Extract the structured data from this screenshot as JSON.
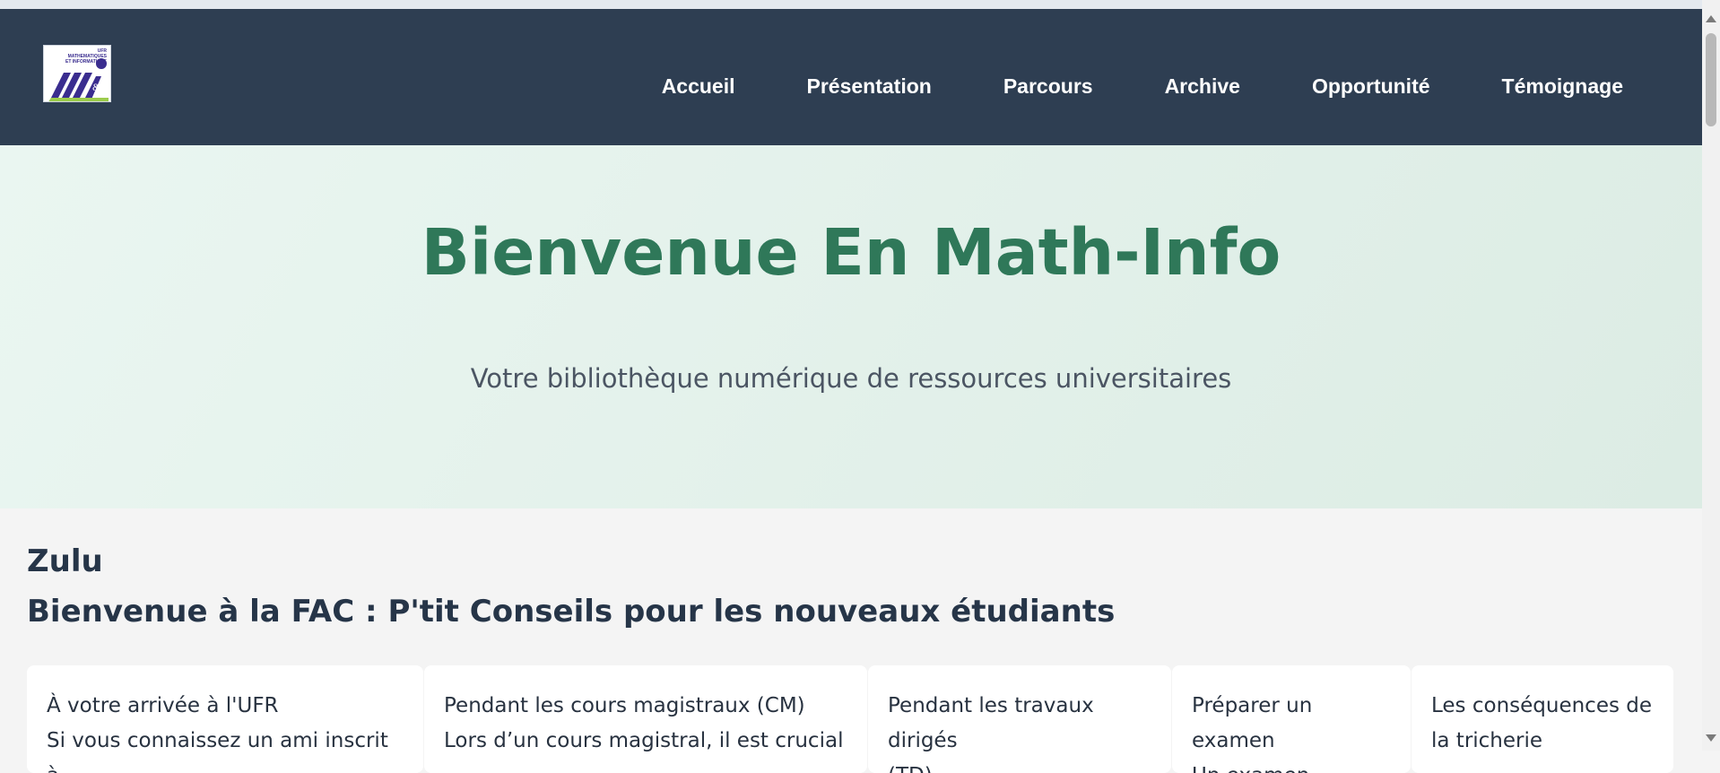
{
  "logo": {
    "line1": "UFR",
    "line2": "MATHEMATIQUES",
    "line3": "ET INFORMATIQUE"
  },
  "nav": {
    "items": [
      {
        "label": "Accueil"
      },
      {
        "label": "Présentation"
      },
      {
        "label": "Parcours"
      },
      {
        "label": "Archive"
      },
      {
        "label": "Opportunité"
      },
      {
        "label": "Témoignage"
      }
    ]
  },
  "hero": {
    "title": "Bienvenue En Math-Info",
    "subtitle": "Votre bibliothèque numérique de ressources universitaires"
  },
  "section": {
    "name": "Zulu",
    "title": "Bienvenue à la FAC : P'tit Conseils pour les nouveaux étudiants"
  },
  "cards": [
    {
      "heading": "À votre arrivée à l'UFR",
      "text": "Si vous connaissez un ami inscrit à"
    },
    {
      "heading": "Pendant les cours magistraux (CM)",
      "text": "Lors d’un cours magistral, il est crucial"
    },
    {
      "heading": "Pendant les travaux dirigés",
      "text": "(TD)"
    },
    {
      "heading": "Préparer un examen",
      "text": "Un examen,"
    },
    {
      "heading": "Les conséquences de",
      "text": "la tricherie"
    }
  ],
  "colors": {
    "navbar": "#2e3e52",
    "hero_title": "#2f7859",
    "section_title": "#263548"
  }
}
